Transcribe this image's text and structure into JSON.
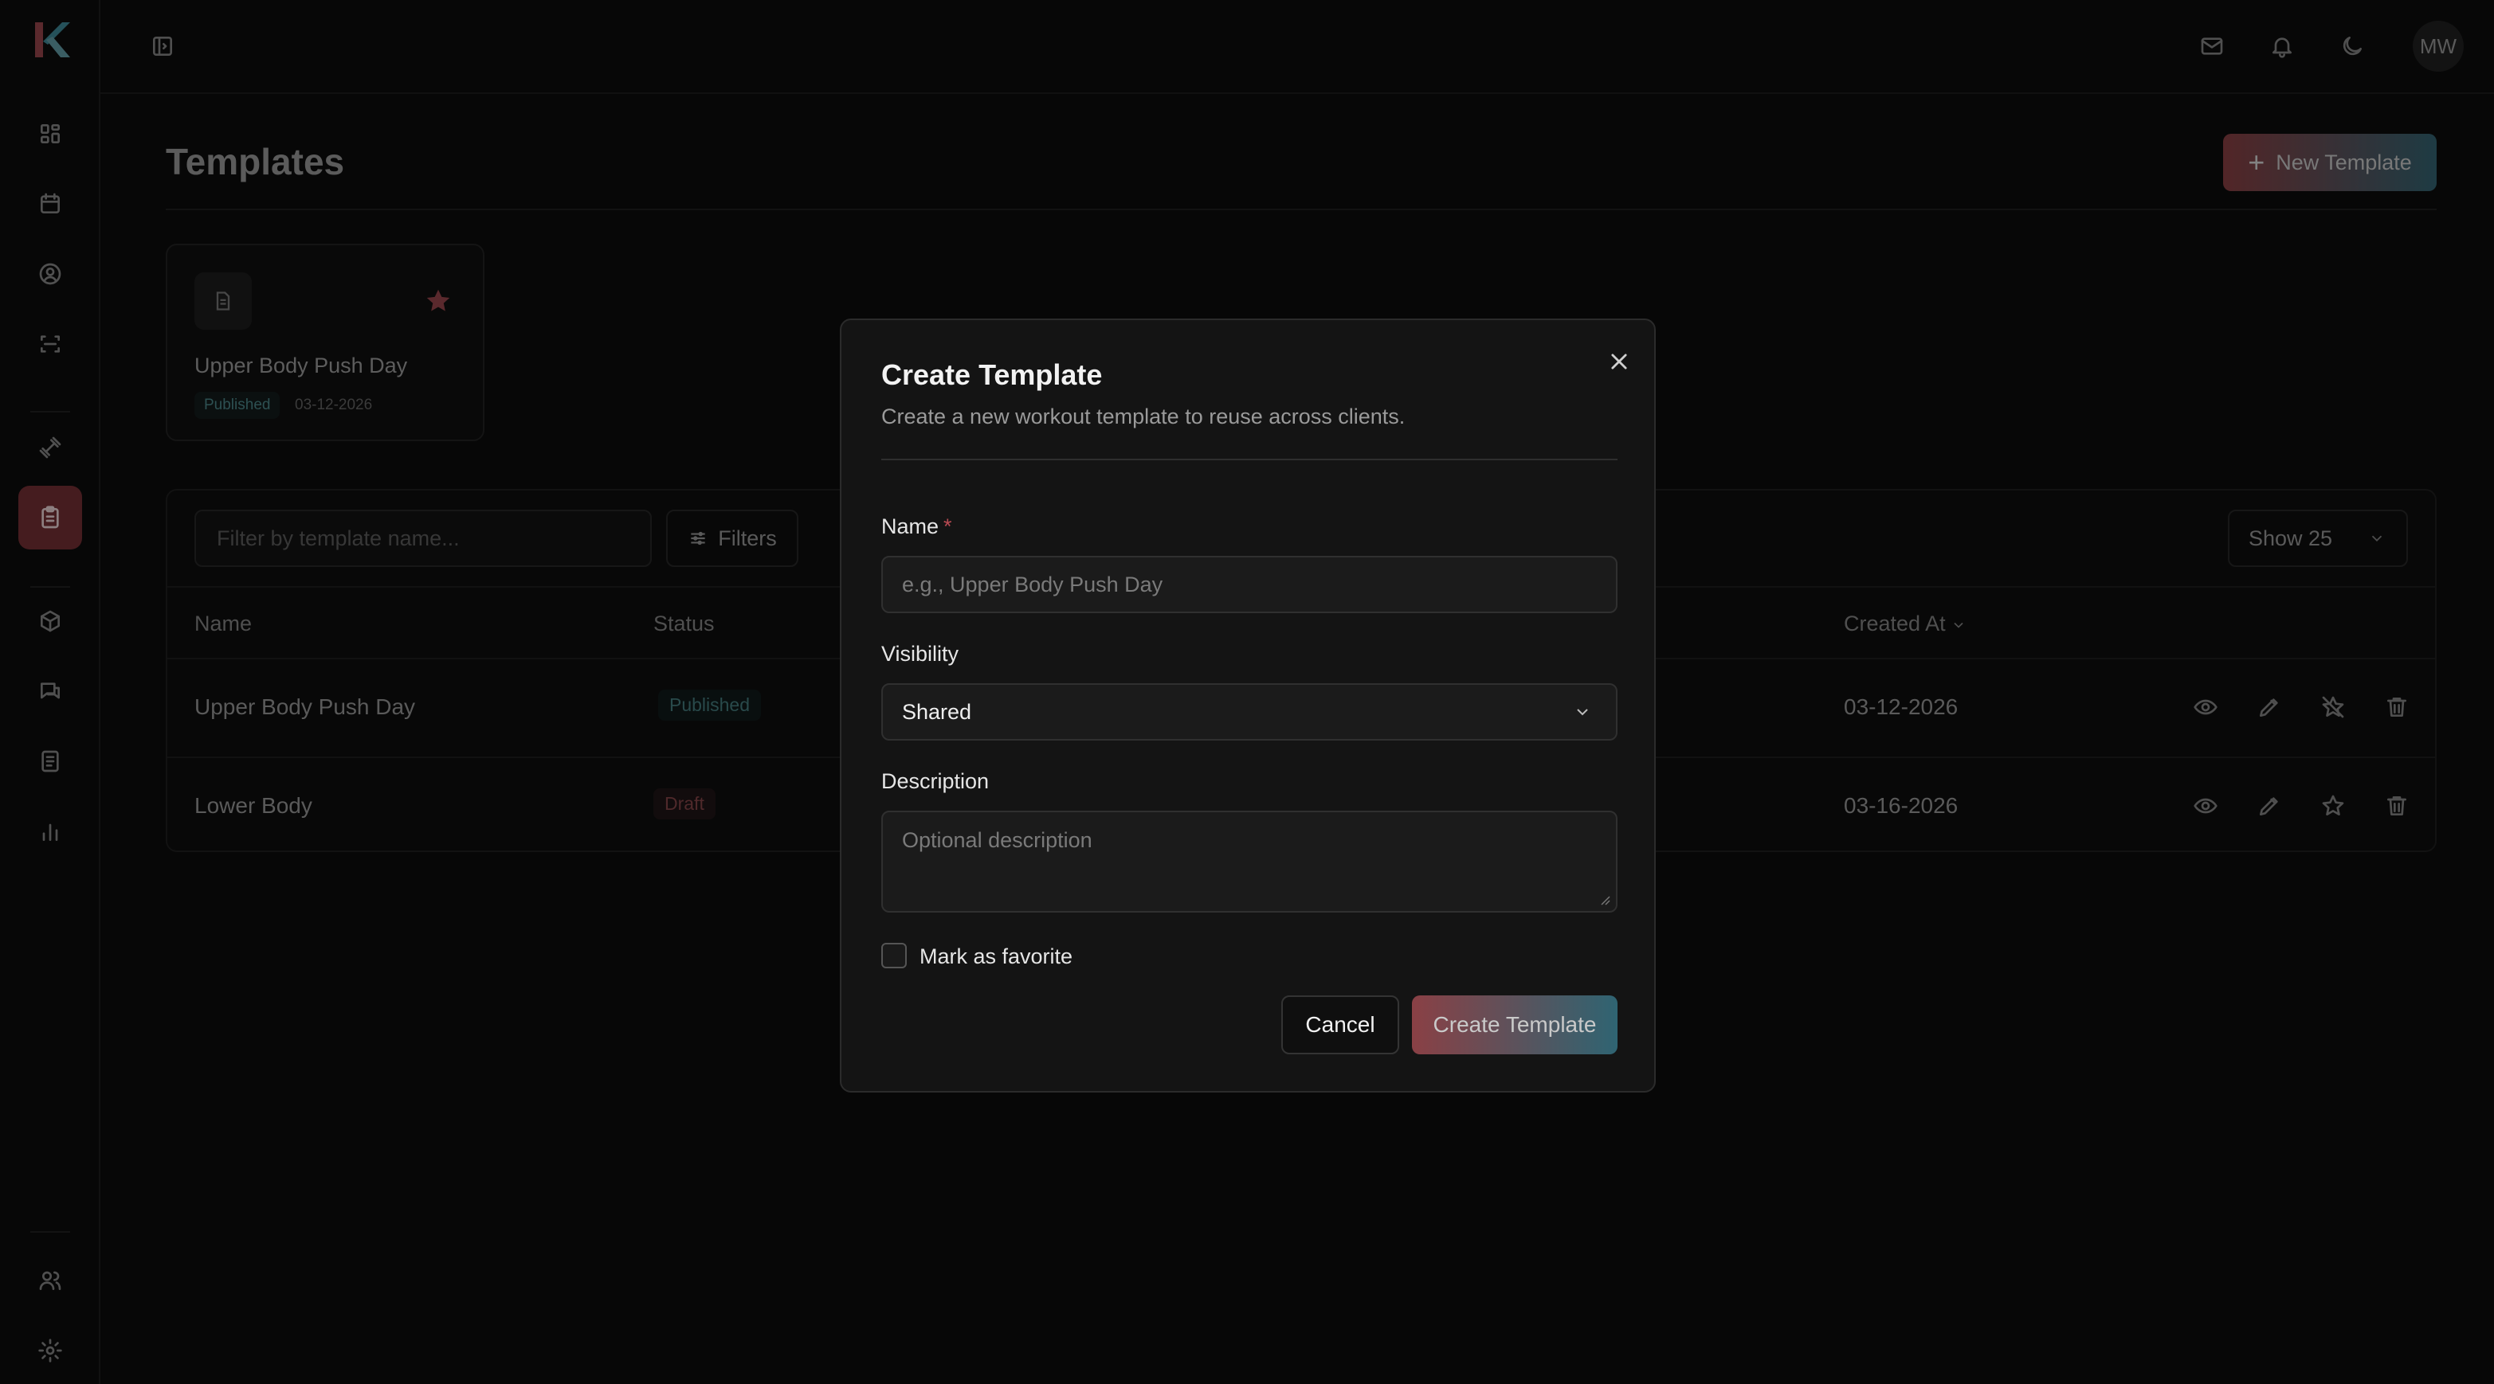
{
  "app": {
    "logo_icon": "k-logo-icon"
  },
  "sidebar": {
    "items": [
      {
        "name": "dashboard",
        "icon": "grid-icon"
      },
      {
        "name": "calendar",
        "icon": "calendar-icon"
      },
      {
        "name": "profile",
        "icon": "user-circle-icon"
      },
      {
        "name": "scan",
        "icon": "scan-icon"
      },
      {
        "name": "workouts",
        "icon": "dumbbell-icon"
      },
      {
        "name": "templates",
        "icon": "clipboard-icon",
        "active": true
      },
      {
        "name": "packages",
        "icon": "box-icon"
      },
      {
        "name": "messages",
        "icon": "chat-icon"
      },
      {
        "name": "documents",
        "icon": "document-icon"
      },
      {
        "name": "reports",
        "icon": "bar-chart-icon"
      },
      {
        "name": "clients",
        "icon": "users-icon"
      },
      {
        "name": "settings",
        "icon": "gear-icon"
      }
    ]
  },
  "topbar": {
    "toggle_icon": "sidebar-toggle-icon",
    "mail_icon": "mail-icon",
    "bell_icon": "bell-icon",
    "theme_icon": "moon-icon",
    "avatar_initials": "MW"
  },
  "page": {
    "title": "Templates",
    "new_button_label": "New Template"
  },
  "favorites": [
    {
      "name": "Upper Body Push Day",
      "status": "Published",
      "date": "03-12-2026"
    }
  ],
  "table": {
    "filter_placeholder": "Filter by template name...",
    "filters_label": "Filters",
    "show_label": "Show 25",
    "columns": {
      "name": "Name",
      "status": "Status",
      "created_at": "Created At"
    },
    "rows": [
      {
        "name": "Upper Body Push Day",
        "status": "Published",
        "created_at": "03-12-2026",
        "favorite": true
      },
      {
        "name": "Lower Body",
        "status": "Draft",
        "created_at": "03-16-2026",
        "favorite": false
      }
    ]
  },
  "dialog": {
    "title": "Create Template",
    "subtitle": "Create a new workout template to reuse across clients.",
    "name_label": "Name",
    "required_mark": "*",
    "name_placeholder": "e.g., Upper Body Push Day",
    "visibility_label": "Visibility",
    "visibility_value": "Shared",
    "description_label": "Description",
    "description_placeholder": "Optional description",
    "favorite_label": "Mark as favorite",
    "favorite_checked": false,
    "cancel_label": "Cancel",
    "submit_label": "Create Template"
  },
  "colors": {
    "accent_red": "#8a4045",
    "accent_teal": "#2f6472",
    "published": "#3f7274",
    "draft": "#7a3f42"
  }
}
